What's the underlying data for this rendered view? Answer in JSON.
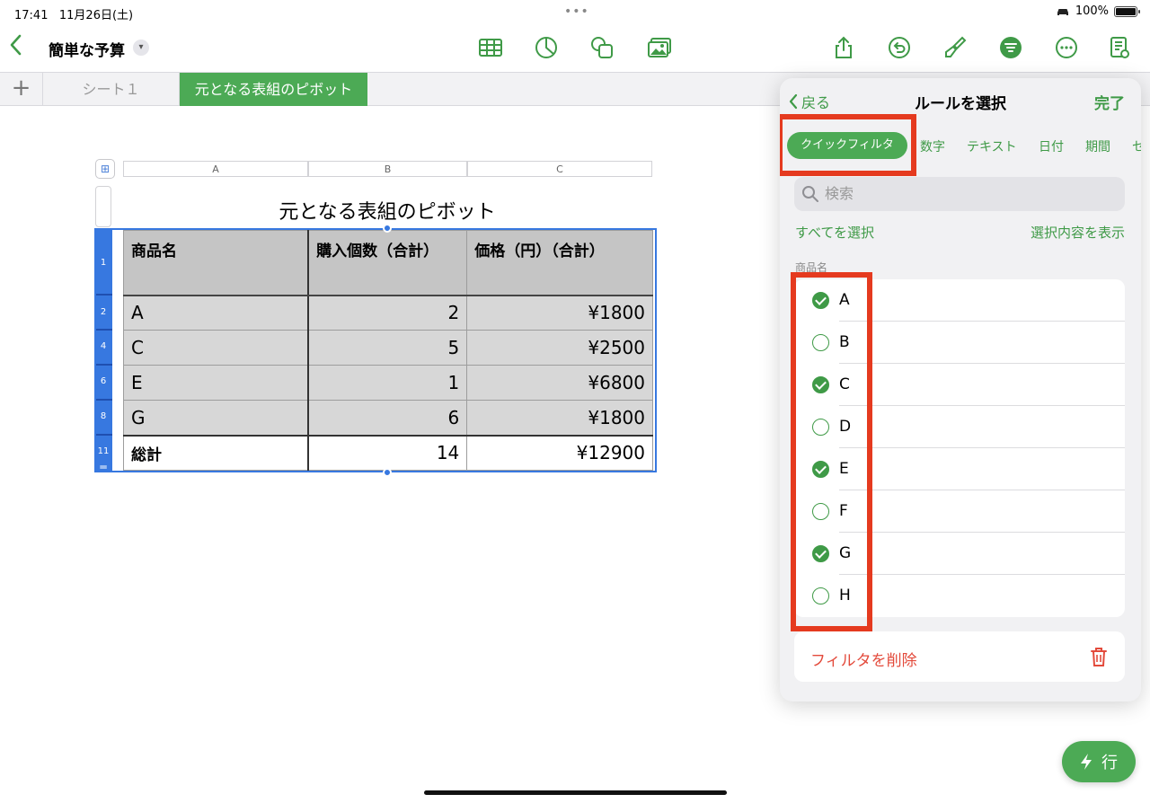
{
  "status": {
    "time": "17:41",
    "date": "11月26日(土)",
    "battery": "100%"
  },
  "toolbar": {
    "back": "‹",
    "title": "簡単な予算",
    "chevron": "⌄"
  },
  "tabs": {
    "add": "+",
    "sheet1": "シート１",
    "sheet2": "元となる表組のピボット"
  },
  "table": {
    "col_headers": [
      "A",
      "B",
      "C"
    ],
    "title": "元となる表組のピボット",
    "header": [
      "商品名",
      "購入個数（合計）",
      "価格（円）（合計）"
    ],
    "rows": [
      {
        "num": "2",
        "name": "A",
        "qty": "2",
        "price": "¥1800"
      },
      {
        "num": "4",
        "name": "C",
        "qty": "5",
        "price": "¥2500"
      },
      {
        "num": "6",
        "name": "E",
        "qty": "1",
        "price": "¥6800"
      },
      {
        "num": "8",
        "name": "G",
        "qty": "6",
        "price": "¥1800"
      }
    ],
    "total": {
      "num": "11",
      "name": "総計",
      "qty": "14",
      "price": "¥12900"
    },
    "header_num": "1"
  },
  "popover": {
    "back": "戻る",
    "title": "ルールを選択",
    "done": "完了",
    "segments": [
      "クイックフィルタ",
      "数字",
      "テキスト",
      "日付",
      "期間",
      "セ"
    ],
    "search_placeholder": "検索",
    "select_all": "すべてを選択",
    "show_selection": "選択内容を表示",
    "section_label": "商品名",
    "items": [
      {
        "label": "A",
        "checked": true
      },
      {
        "label": "B",
        "checked": false
      },
      {
        "label": "C",
        "checked": true
      },
      {
        "label": "D",
        "checked": false
      },
      {
        "label": "E",
        "checked": true
      },
      {
        "label": "F",
        "checked": false
      },
      {
        "label": "G",
        "checked": true
      },
      {
        "label": "H",
        "checked": false
      }
    ],
    "delete_filter": "フィルタを削除"
  },
  "fab": {
    "label": "行"
  },
  "colors": {
    "accent": "#4caa55",
    "selection": "#3778e0",
    "highlight": "#e53a1f",
    "destructive": "#e34a3b"
  }
}
